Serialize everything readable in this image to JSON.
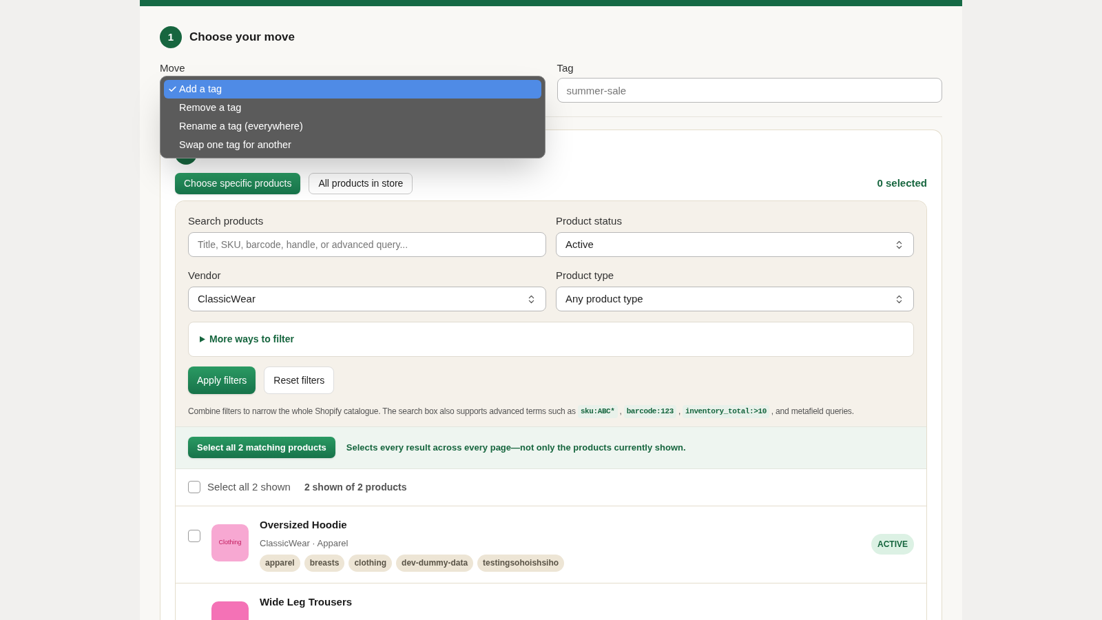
{
  "step1": {
    "number": "1",
    "title": "Choose your move"
  },
  "move": {
    "label": "Move",
    "options": [
      {
        "label": "Add a tag",
        "selected": true
      },
      {
        "label": "Remove a tag",
        "selected": false
      },
      {
        "label": "Rename a tag (everywhere)",
        "selected": false
      },
      {
        "label": "Swap one tag for another",
        "selected": false
      }
    ]
  },
  "tag": {
    "label": "Tag",
    "placeholder": "summer-sale"
  },
  "scope_buttons": [
    {
      "label": "Choose specific products",
      "selected": true
    },
    {
      "label": "All products in store",
      "selected": false
    }
  ],
  "selected_count": "0 selected",
  "filters": [
    {
      "kind": "search",
      "label": "Search products",
      "placeholder": "Title, SKU, barcode, handle, or advanced query..."
    },
    {
      "kind": "select",
      "label": "Product status",
      "value": "Active"
    },
    {
      "kind": "select",
      "label": "Vendor",
      "value": "ClassicWear"
    },
    {
      "kind": "select",
      "label": "Product type",
      "value": "Any product type"
    }
  ],
  "more_filters": {
    "label": "More ways to filter",
    "expanded": false
  },
  "apply_button": "Apply filters",
  "reset_button": "Reset filters",
  "help": [
    {
      "kind": "text",
      "text": "Combine filters to narrow the whole Shopify catalogue. The search box also supports advanced terms such as"
    },
    {
      "kind": "code",
      "text": "sku:ABC*"
    },
    {
      "kind": "text",
      "text": ","
    },
    {
      "kind": "code",
      "text": "barcode:123"
    },
    {
      "kind": "text",
      "text": ","
    },
    {
      "kind": "code",
      "text": "inventory_total:>10"
    },
    {
      "kind": "text",
      "text": ", and metafield queries."
    }
  ],
  "bulk": {
    "button": "Select all 2 matching products",
    "note": "Selects every result across every page—not only the products currently shown."
  },
  "list_header": {
    "select_all": {
      "label": "Select all 2 shown",
      "checked": false
    },
    "count": "2 shown of 2 products"
  },
  "products": [
    {
      "title": "Oversized Hoodie",
      "thumb_label": "Clothing",
      "color": "#f7a8d2",
      "meta": "ClassicWear · Apparel",
      "tags": [
        "apparel",
        "breasts",
        "clothing",
        "dev-dummy-data",
        "testingsohoishsiho"
      ],
      "status": "ACTIVE",
      "checked": false
    },
    {
      "title": "Wide Leg Trousers",
      "color": "#f472b6"
    }
  ]
}
